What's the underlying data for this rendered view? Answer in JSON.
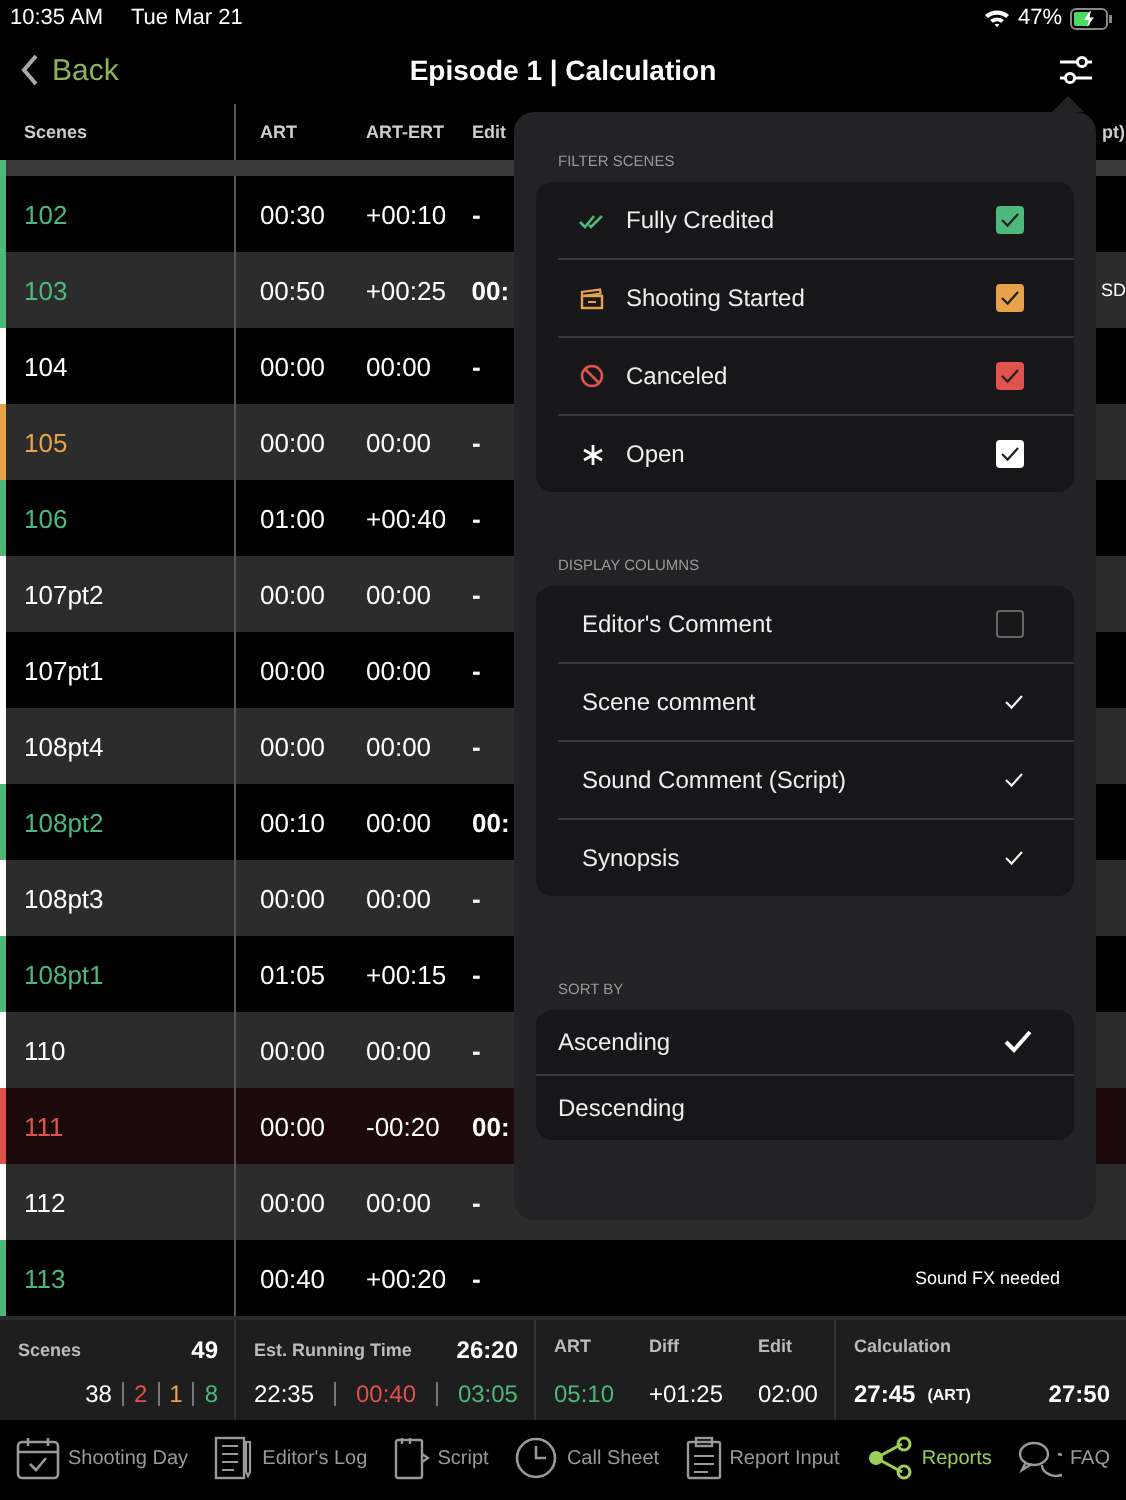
{
  "status_bar": {
    "time": "10:35 AM",
    "date": "Tue Mar 21",
    "battery": "47%"
  },
  "nav": {
    "back": "Back",
    "title": "Episode 1 | Calculation"
  },
  "table": {
    "columns": [
      "Scenes",
      "ART",
      "ART-ERT",
      "Edit",
      "pt)"
    ],
    "rows": [
      {
        "scene": "102",
        "color": "#4cb87a",
        "canceled": false,
        "art": "00:30",
        "art_ert": "+00:10",
        "edit": "-"
      },
      {
        "scene": "103",
        "color": "#4cb87a",
        "canceled": false,
        "art": "00:50",
        "art_ert": "+00:25",
        "edit": "00:",
        "column_6": "SD"
      },
      {
        "scene": "104",
        "color": "#ffffff",
        "canceled": false,
        "art": "00:00",
        "art_ert": "00:00",
        "edit": "-"
      },
      {
        "scene": "105",
        "color": "#e8a24a",
        "canceled": false,
        "art": "00:00",
        "art_ert": "00:00",
        "edit": "-"
      },
      {
        "scene": "106",
        "color": "#4cb87a",
        "canceled": false,
        "art": "01:00",
        "art_ert": "+00:40",
        "edit": "-"
      },
      {
        "scene": "107pt2",
        "color": "#ffffff",
        "canceled": false,
        "art": "00:00",
        "art_ert": "00:00",
        "edit": "-"
      },
      {
        "scene": "107pt1",
        "color": "#ffffff",
        "canceled": false,
        "art": "00:00",
        "art_ert": "00:00",
        "edit": "-"
      },
      {
        "scene": "108pt4",
        "color": "#ffffff",
        "canceled": false,
        "art": "00:00",
        "art_ert": "00:00",
        "edit": "-"
      },
      {
        "scene": "108pt2",
        "color": "#4cb87a",
        "canceled": false,
        "art": "00:10",
        "art_ert": "00:00",
        "edit": "00:"
      },
      {
        "scene": "108pt3",
        "color": "#ffffff",
        "canceled": false,
        "art": "00:00",
        "art_ert": "00:00",
        "edit": "-"
      },
      {
        "scene": "108pt1",
        "color": "#4cb87a",
        "canceled": false,
        "art": "01:05",
        "art_ert": "+00:15",
        "edit": "-"
      },
      {
        "scene": "110",
        "color": "#ffffff",
        "canceled": false,
        "art": "00:00",
        "art_ert": "00:00",
        "edit": "-"
      },
      {
        "scene": "111",
        "color": "#e0524c",
        "canceled": true,
        "art": "00:00",
        "art_ert": "-00:20",
        "edit": "00:"
      },
      {
        "scene": "112",
        "color": "#ffffff",
        "canceled": false,
        "art": "00:00",
        "art_ert": "00:00",
        "edit": "-"
      },
      {
        "scene": "113",
        "color": "#4cb87a",
        "canceled": false,
        "art": "00:40",
        "art_ert": "+00:20",
        "edit": "-",
        "column_5": "Sound FX needed"
      }
    ]
  },
  "popover": {
    "filter_title": "FILTER SCENES",
    "filters": [
      {
        "kind": "credited",
        "label": "Fully Credited",
        "color": "#4cb87a",
        "checked": true
      },
      {
        "kind": "started",
        "label": "Shooting Started",
        "color": "#e8a24a",
        "checked": true
      },
      {
        "kind": "canceled",
        "label": "Canceled",
        "color": "#e0524c",
        "checked": true
      },
      {
        "kind": "open",
        "label": "Open",
        "color": "#ffffff",
        "checked": true
      }
    ],
    "columns_title": "DISPLAY COLUMNS",
    "display_columns": [
      {
        "label": "Editor's Comment",
        "checked": false
      },
      {
        "label": "Scene comment",
        "checked": true
      },
      {
        "label": "Sound Comment (Script)",
        "checked": true
      },
      {
        "label": "Synopsis",
        "checked": true
      }
    ],
    "sort_title": "SORT BY",
    "sort": [
      {
        "label": "Ascending",
        "selected": true
      },
      {
        "label": "Descending",
        "selected": false
      }
    ]
  },
  "summary": {
    "scenes": {
      "label": "Scenes",
      "total": "49",
      "counts": [
        {
          "value": "38",
          "color": "#ffffff"
        },
        {
          "value": "2",
          "color": "#e0524c"
        },
        {
          "value": "1",
          "color": "#e8a24a"
        },
        {
          "value": "8",
          "color": "#4cb87a"
        }
      ]
    },
    "running": {
      "label": "Est. Running Time",
      "total": "26:20",
      "values": [
        {
          "value": "22:35",
          "color": "#ffffff"
        },
        {
          "value": "00:40",
          "color": "#e0524c"
        },
        {
          "value": "03:05",
          "color": "#4cb87a"
        }
      ]
    },
    "stats": [
      {
        "label": "ART",
        "value": "05:10",
        "color": "#4cb87a"
      },
      {
        "label": "Diff",
        "value": "+01:25",
        "color": "#ffffff"
      },
      {
        "label": "Edit",
        "value": "02:00",
        "color": "#ffffff"
      }
    ],
    "calculation": {
      "label": "Calculation",
      "value": "27:45",
      "tag": "(ART)",
      "total": "27:50"
    }
  },
  "tabs": [
    {
      "kind": "calendar",
      "label": "Shooting Day",
      "selected": false
    },
    {
      "kind": "log",
      "label": "Editor's Log",
      "selected": false
    },
    {
      "kind": "script",
      "label": "Script",
      "selected": false
    },
    {
      "kind": "clock",
      "label": "Call Sheet",
      "selected": false
    },
    {
      "kind": "clipboard",
      "label": "Report Input",
      "selected": false
    },
    {
      "kind": "share",
      "label": "Reports",
      "selected": true
    },
    {
      "kind": "chat",
      "label": "FAQ",
      "selected": false
    }
  ]
}
